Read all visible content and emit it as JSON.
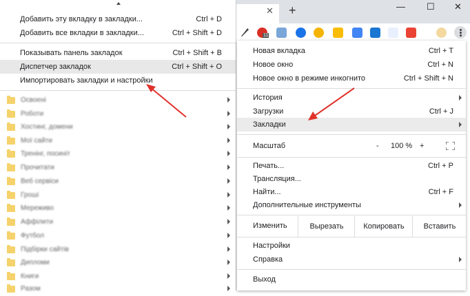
{
  "bookmarks_submenu": {
    "items": [
      {
        "label": "Добавить эту вкладку в закладки...",
        "shortcut": "Ctrl + D"
      },
      {
        "label": "Добавить все вкладки в закладки...",
        "shortcut": "Ctrl + Shift + D"
      },
      {
        "label": "Показывать панель закладок",
        "shortcut": "Ctrl + Shift + B"
      },
      {
        "label": "Диспетчер закладок",
        "shortcut": "Ctrl + Shift + O"
      },
      {
        "label": "Импортировать закладки и настройки",
        "shortcut": ""
      }
    ],
    "folders": [
      "Освоені",
      "Роботи",
      "Хостинг, домени",
      "Мої сайти",
      "Тренінг, посиніт",
      "Прочитати",
      "Веб сервіси",
      "Гроші",
      "Мереживо",
      "Аффілити",
      "Футбол",
      "Підбірки сайтів",
      "Дипломи",
      "Книги",
      "Разом"
    ]
  },
  "browser": {
    "tab_close": "✕",
    "new_tab": "+",
    "window_controls": [
      "—",
      "☐",
      "✕"
    ],
    "extension_badge": "11"
  },
  "menu": {
    "group1": [
      {
        "label": "Новая вкладка",
        "shortcut": "Ctrl + T"
      },
      {
        "label": "Новое окно",
        "shortcut": "Ctrl + N"
      },
      {
        "label": "Новое окно в режиме инкогнито",
        "shortcut": "Ctrl + Shift + N"
      }
    ],
    "group2": [
      {
        "label": "История",
        "shortcut": ""
      },
      {
        "label": "Загрузки",
        "shortcut": "Ctrl + J"
      },
      {
        "label": "Закладки",
        "shortcut": ""
      }
    ],
    "zoom": {
      "label": "Масштаб",
      "minus": "-",
      "value": "100 %",
      "plus": "+"
    },
    "group3": [
      {
        "label": "Печать...",
        "shortcut": "Ctrl + P"
      },
      {
        "label": "Трансляция...",
        "shortcut": ""
      },
      {
        "label": "Найти...",
        "shortcut": "Ctrl + F"
      },
      {
        "label": "Дополнительные инструменты",
        "shortcut": ""
      }
    ],
    "edit": {
      "label": "Изменить",
      "cut": "Вырезать",
      "copy": "Копировать",
      "paste": "Вставить"
    },
    "group4": [
      {
        "label": "Настройки",
        "shortcut": ""
      },
      {
        "label": "Справка",
        "shortcut": ""
      }
    ],
    "exit": "Выход"
  },
  "colors": {
    "highlight": "#e8e8e8",
    "arrow": "#e0322b",
    "folder": "#f5d26b"
  }
}
